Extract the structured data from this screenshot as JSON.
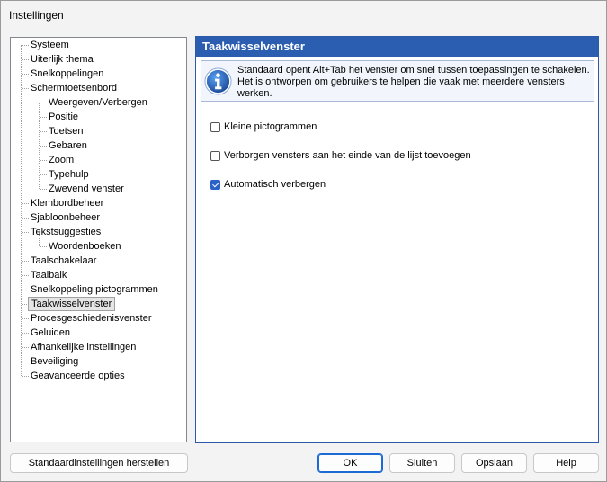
{
  "window": {
    "title": "Instellingen"
  },
  "tree": {
    "items": [
      {
        "label": "Systeem"
      },
      {
        "label": "Uiterlijk thema"
      },
      {
        "label": "Snelkoppelingen"
      },
      {
        "label": "Schermtoetsenbord"
      },
      {
        "label": "Weergeven/Verbergen"
      },
      {
        "label": "Positie"
      },
      {
        "label": "Toetsen"
      },
      {
        "label": "Gebaren"
      },
      {
        "label": "Zoom"
      },
      {
        "label": "Typehulp"
      },
      {
        "label": "Zwevend venster"
      },
      {
        "label": "Klembordbeheer"
      },
      {
        "label": "Sjabloonbeheer"
      },
      {
        "label": "Tekstsuggesties"
      },
      {
        "label": "Woordenboeken"
      },
      {
        "label": "Taalschakelaar"
      },
      {
        "label": "Taalbalk"
      },
      {
        "label": "Snelkoppeling pictogrammen"
      },
      {
        "label": "Taakwisselvenster"
      },
      {
        "label": "Procesgeschiedenisvenster"
      },
      {
        "label": "Geluiden"
      },
      {
        "label": "Afhankelijke instellingen"
      },
      {
        "label": "Beveiliging"
      },
      {
        "label": "Geavanceerde opties"
      }
    ],
    "selected": "Taakwisselvenster"
  },
  "panel": {
    "header": "Taakwisselvenster",
    "info_icon": "info-icon",
    "info_text": "Standaard opent Alt+Tab het venster om snel tussen toepassingen te schakelen. Het is ontworpen om gebruikers te helpen die vaak met meerdere vensters werken.",
    "options": [
      {
        "label": "Kleine pictogrammen",
        "checked": false
      },
      {
        "label": "Verborgen vensters aan het einde van de lijst toevoegen",
        "checked": false
      },
      {
        "label": "Automatisch verbergen",
        "checked": true
      }
    ]
  },
  "buttons": {
    "restore": "Standaardinstellingen herstellen",
    "ok": "OK",
    "close": "Sluiten",
    "save": "Opslaan",
    "help": "Help"
  },
  "colors": {
    "header_bg": "#2b5eb0",
    "accent": "#2a62c9"
  }
}
